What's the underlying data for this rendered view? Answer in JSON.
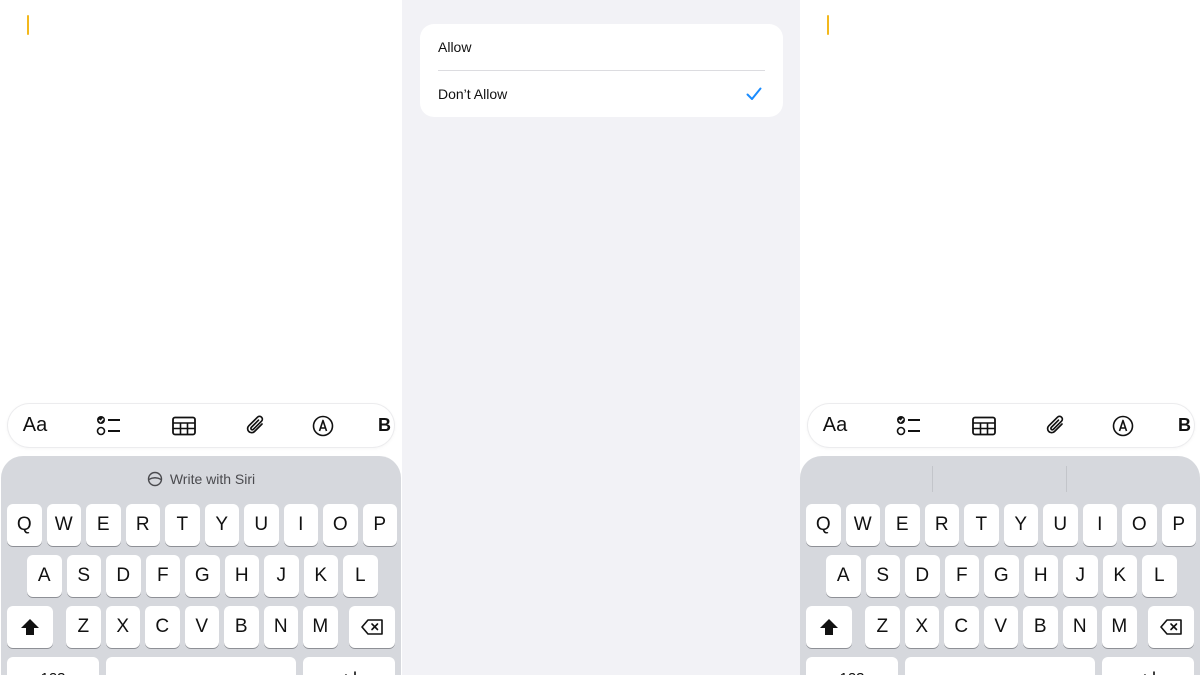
{
  "toolbar": {
    "format_label": "Aa",
    "more_label": "B",
    "icons": [
      "checklist-icon",
      "table-icon",
      "paperclip-icon",
      "markup-pen-icon"
    ]
  },
  "keyboard_left": {
    "suggestion": "Write with Siri",
    "rows": [
      [
        "Q",
        "W",
        "E",
        "R",
        "T",
        "Y",
        "U",
        "I",
        "O",
        "P"
      ],
      [
        "A",
        "S",
        "D",
        "F",
        "G",
        "H",
        "J",
        "K",
        "L"
      ],
      [
        "Z",
        "X",
        "C",
        "V",
        "B",
        "N",
        "M"
      ]
    ],
    "numbers_label": "123"
  },
  "keyboard_right": {
    "rows": [
      [
        "Q",
        "W",
        "E",
        "R",
        "T",
        "Y",
        "U",
        "I",
        "O",
        "P"
      ],
      [
        "A",
        "S",
        "D",
        "F",
        "G",
        "H",
        "J",
        "K",
        "L"
      ],
      [
        "Z",
        "X",
        "C",
        "V",
        "B",
        "N",
        "M"
      ]
    ],
    "numbers_label": "123"
  },
  "permission": {
    "options": [
      {
        "label": "Allow",
        "selected": false
      },
      {
        "label": "Don’t Allow",
        "selected": true
      }
    ],
    "accent": "#1a8cff"
  },
  "colors": {
    "cursor": "#f3b81c",
    "keyboard_bg": "#d6d8dd",
    "settings_bg": "#f2f2f6"
  }
}
